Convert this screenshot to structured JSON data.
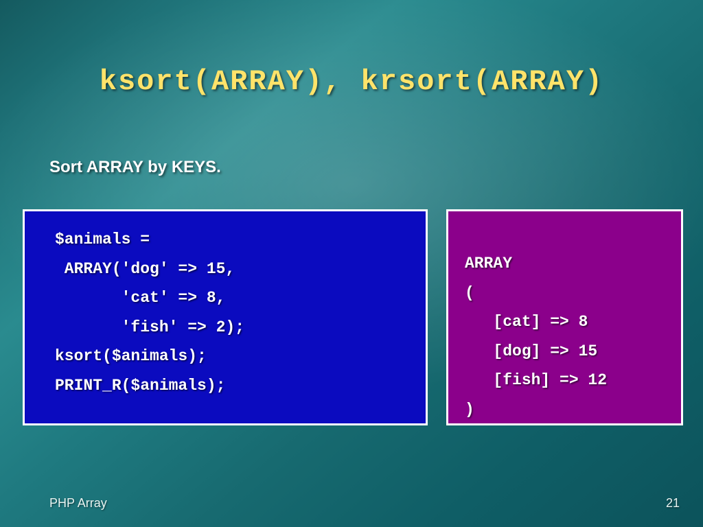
{
  "title": "ksort(ARRAY), krsort(ARRAY)",
  "subtitle": "Sort  ARRAY by KEYS.",
  "code_left": "$animals =\n ARRAY('dog' => 15,\n       'cat' => 8,\n       'fish' => 2);\nksort($animals);\nPRINT_R($animals);",
  "code_right": "ARRAY\n(\n   [cat] => 8\n   [dog] => 15\n   [fish] => 12\n)",
  "footer": {
    "left": "PHP Array",
    "page": "21"
  }
}
